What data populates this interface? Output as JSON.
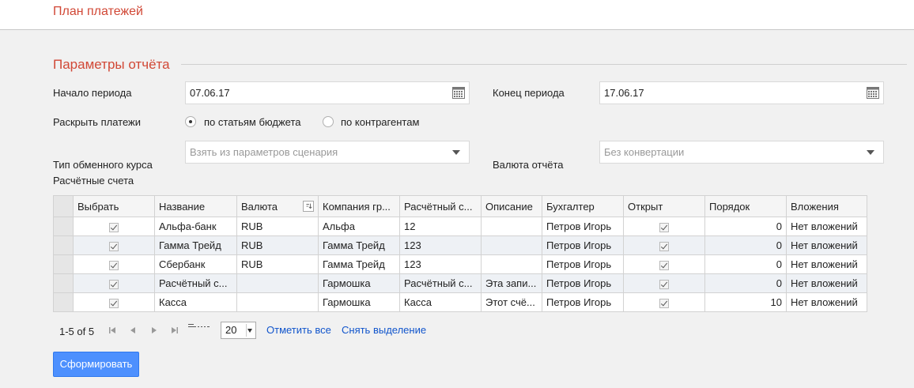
{
  "header": {
    "title": "План платежей"
  },
  "params": {
    "section_title": "Параметры отчёта",
    "period_start": {
      "label": "Начало периода",
      "value": "07.06.17"
    },
    "period_end": {
      "label": "Конец периода",
      "value": "17.06.17"
    },
    "expand": {
      "label": "Раскрыть платежи",
      "option_budget": "по статьям бюджета",
      "option_counterparty": "по контрагентам",
      "selected": "budget"
    },
    "rate_type": {
      "label": "Тип обменного курса",
      "placeholder": "Взять из параметров сценария"
    },
    "currency": {
      "label": "Валюта отчёта",
      "placeholder": "Без конвертации"
    },
    "accounts_label": "Расчётные счета"
  },
  "grid": {
    "columns": [
      "Выбрать",
      "Название",
      "Валюта",
      "Компания гр...",
      "Расчётный с...",
      "Описание",
      "Бухгалтер",
      "Открыт",
      "Порядок",
      "Вложения"
    ],
    "rows": [
      {
        "name": "Альфа-банк",
        "currency": "RUB",
        "company": "Альфа",
        "account": "12",
        "description": "",
        "accountant": "Петров Игорь",
        "order": "0",
        "attachments": "Нет вложений"
      },
      {
        "name": "Гамма Трейд",
        "currency": "RUB",
        "company": "Гамма Трейд",
        "account": "123",
        "description": "",
        "accountant": "Петров Игорь",
        "order": "0",
        "attachments": "Нет вложений"
      },
      {
        "name": "Сбербанк",
        "currency": "RUB",
        "company": "Гамма Трейд",
        "account": "123",
        "description": "",
        "accountant": "Петров Игорь",
        "order": "0",
        "attachments": "Нет вложений"
      },
      {
        "name": "Расчётный с...",
        "currency": "",
        "company": "Гармошка",
        "account": "Расчётный с...",
        "description": "Эта запи...",
        "accountant": "Петров Игорь",
        "order": "0",
        "attachments": "Нет вложений"
      },
      {
        "name": "Касса",
        "currency": "",
        "company": "Гармошка",
        "account": "Касса",
        "description": "Этот счё...",
        "accountant": "Петров Игорь",
        "order": "10",
        "attachments": "Нет вложений"
      }
    ]
  },
  "pager": {
    "range": "1-5 of 5",
    "page_size": "20",
    "select_all": "Отметить все",
    "clear_selection": "Снять выделение"
  },
  "actions": {
    "generate": "Сформировать"
  },
  "colors": {
    "accent": "#d14836",
    "primary": "#4d90fe",
    "link": "#1155cc"
  }
}
